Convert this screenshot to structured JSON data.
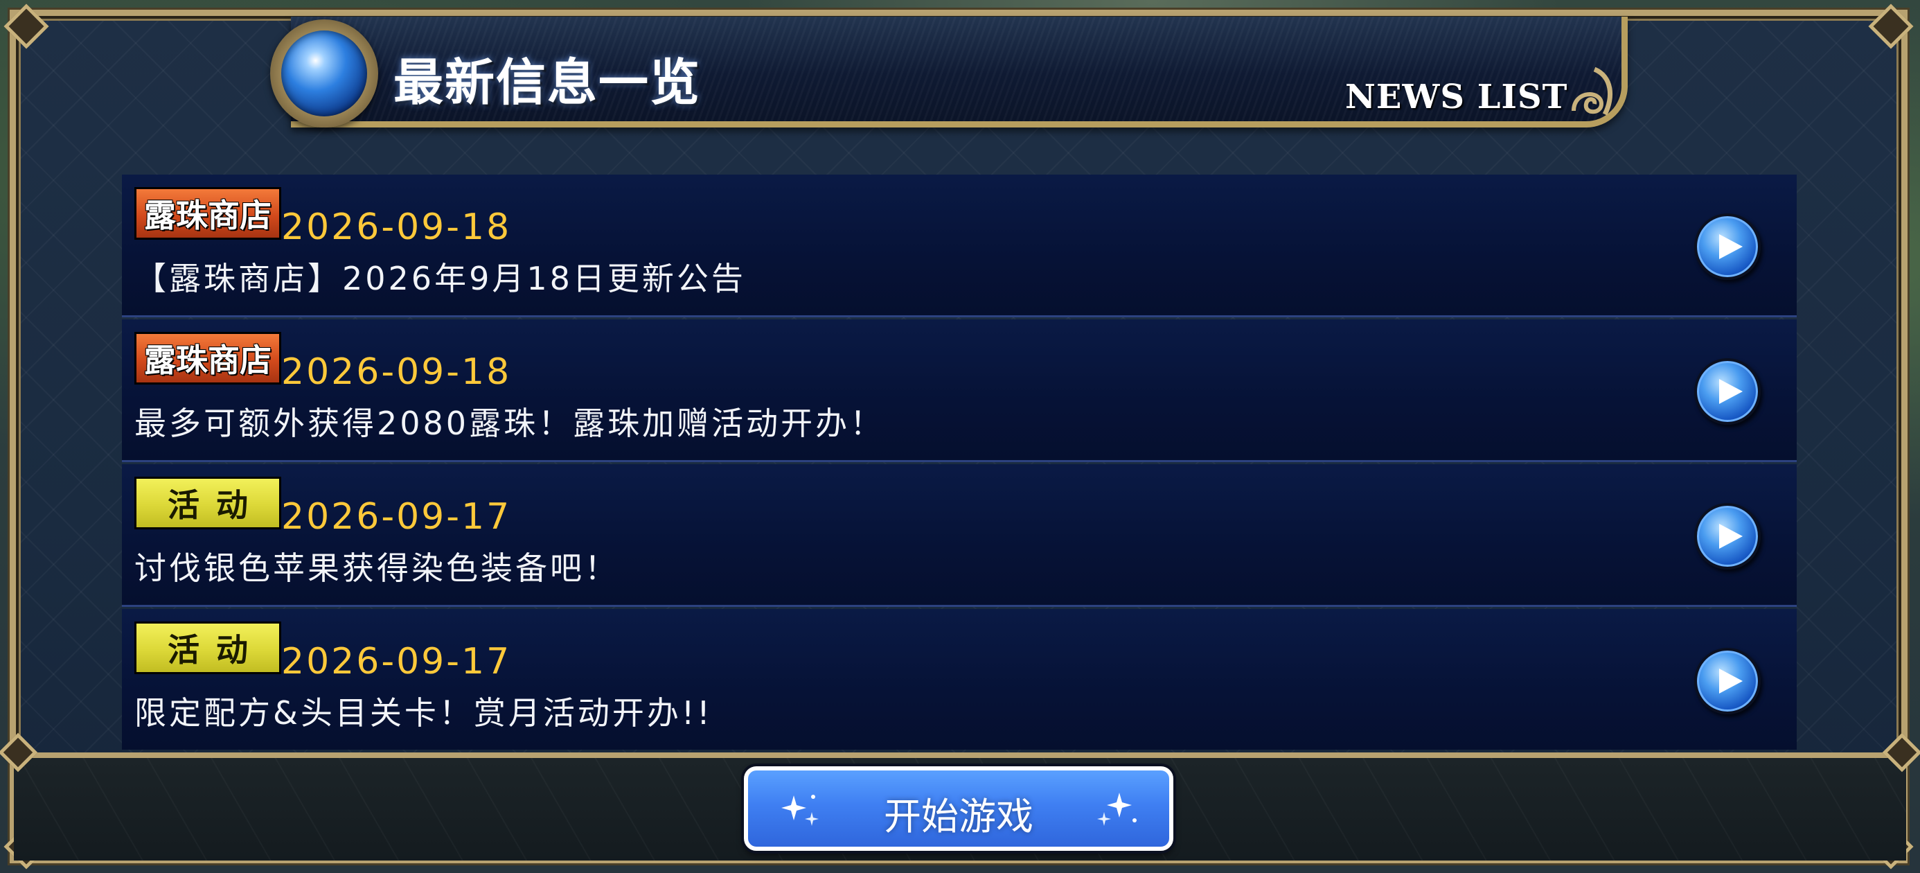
{
  "header": {
    "title": "最新信息一览",
    "subtitle": "NEWS LIST"
  },
  "news": [
    {
      "tag": "露珠商店",
      "tag_type": "shop",
      "date": "2026-09-18",
      "headline": "【露珠商店】2026年9月18日更新公告"
    },
    {
      "tag": "露珠商店",
      "tag_type": "shop",
      "date": "2026-09-18",
      "headline": "最多可额外获得2080露珠！露珠加赠活动开办！"
    },
    {
      "tag": "活动",
      "tag_type": "event",
      "date": "2026-09-17",
      "headline": "讨伐银色苹果获得染色装备吧！"
    },
    {
      "tag": "活动",
      "tag_type": "event",
      "date": "2026-09-17",
      "headline": "限定配方&头目关卡！赏月活动开办!!"
    }
  ],
  "footer": {
    "start_label": "开始游戏"
  },
  "colors": {
    "date": "#ffc93a",
    "tag_shop": "#d24a1c",
    "tag_event": "#dcd838",
    "start_button": "#3f7ff2",
    "frame_gold": "#b8a270"
  }
}
